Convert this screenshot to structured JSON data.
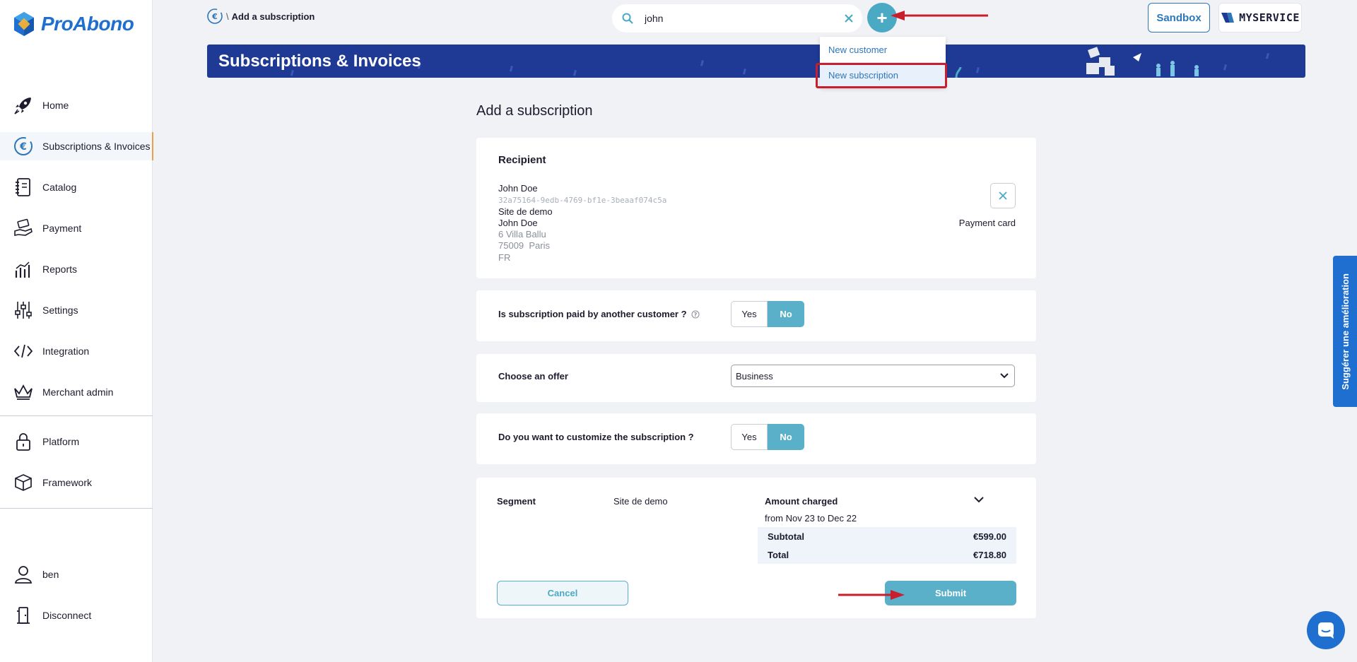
{
  "brand": {
    "name": "ProAbono"
  },
  "sidebar": {
    "items": [
      {
        "label": "Home",
        "icon": "rocket-icon"
      },
      {
        "label": "Subscriptions & Invoices",
        "icon": "euro-cycle-icon",
        "active": true
      },
      {
        "label": "Catalog",
        "icon": "notebook-icon"
      },
      {
        "label": "Payment",
        "icon": "payment-hand-icon"
      },
      {
        "label": "Reports",
        "icon": "reports-chart-icon"
      },
      {
        "label": "Settings",
        "icon": "sliders-icon"
      },
      {
        "label": "Integration",
        "icon": "code-icon"
      },
      {
        "label": "Merchant admin",
        "icon": "crown-icon"
      }
    ],
    "secondary": [
      {
        "label": "Platform",
        "icon": "lock-icon"
      },
      {
        "label": "Framework",
        "icon": "cube-icon"
      }
    ],
    "user": [
      {
        "label": "ben",
        "icon": "user-icon"
      },
      {
        "label": "Disconnect",
        "icon": "door-icon"
      }
    ]
  },
  "topbar": {
    "breadcrumb_sep": "\\",
    "breadcrumb": "Add a subscription",
    "search_value": "john",
    "plus_label": "+",
    "sandbox_label": "Sandbox",
    "service_label": "MYSERVICE"
  },
  "dropdown": {
    "items": [
      {
        "label": "New customer"
      },
      {
        "label": "New subscription"
      }
    ]
  },
  "banner": {
    "title": "Subscriptions & Invoices"
  },
  "page": {
    "title": "Add a subscription"
  },
  "recipient": {
    "heading": "Recipient",
    "name": "John Doe",
    "id": "32a75164-9edb-4769-bf1e-3beaaf074c5a",
    "site": "Site de demo",
    "contact": "John Doe",
    "street": "6 Villa Ballu",
    "city": "75009  Paris",
    "country": "FR",
    "payment": "Payment card"
  },
  "paid_by_other": {
    "question": "Is subscription paid by another customer ?",
    "yes": "Yes",
    "no": "No",
    "selected": "No"
  },
  "offer": {
    "label": "Choose an offer",
    "value": "Business"
  },
  "customize": {
    "question": "Do you want to customize the subscription ?",
    "yes": "Yes",
    "no": "No",
    "selected": "No"
  },
  "summary": {
    "segment_label": "Segment",
    "segment_value": "Site de demo",
    "amount_label": "Amount charged",
    "period": "from Nov 23 to Dec 22",
    "subtotal_label": "Subtotal",
    "subtotal_value": "€599.00",
    "total_label": "Total",
    "total_value": "€718.80"
  },
  "actions": {
    "cancel": "Cancel",
    "submit": "Submit"
  },
  "feedback": {
    "label": "Suggérer une amélioration"
  },
  "colors": {
    "accent": "#5bb0c9",
    "brand": "#1e6fd0",
    "banner": "#1e3a94",
    "annotation": "#c81e2e"
  }
}
